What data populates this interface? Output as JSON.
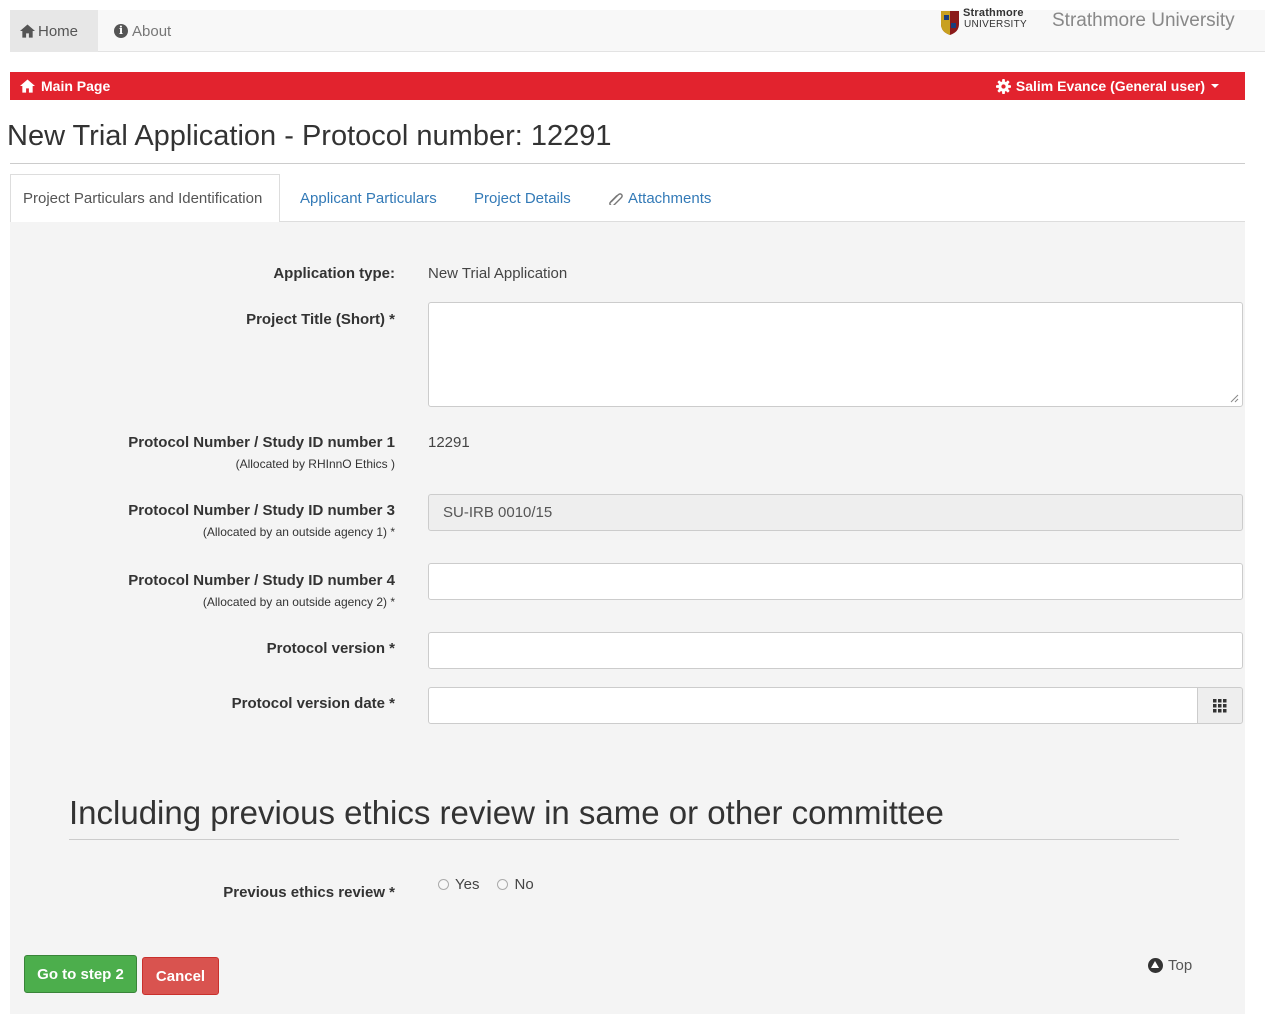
{
  "topnav": {
    "home_label": "Home",
    "about_label": "About",
    "logo_word1": "Strathmore",
    "logo_word2": "UNIVERSITY",
    "brand_name": "Strathmore University"
  },
  "redbar": {
    "main_page_label": "Main Page",
    "user_label": "Salim Evance (General user)"
  },
  "page": {
    "title": "New Trial Application - Protocol number: 12291"
  },
  "tabs": [
    {
      "label": "Project Particulars and Identification",
      "active": true
    },
    {
      "label": "Applicant Particulars",
      "active": false
    },
    {
      "label": "Project Details",
      "active": false
    },
    {
      "label": "Attachments",
      "active": false,
      "icon": "paperclip-icon"
    }
  ],
  "form": {
    "application_type": {
      "label": "Application type:",
      "value": "New Trial Application"
    },
    "project_title": {
      "label": "Project Title (Short) *",
      "value": ""
    },
    "protocol_1": {
      "label": "Protocol Number / Study ID number 1",
      "sub": "(Allocated by RHInnO Ethics )",
      "value": "12291"
    },
    "protocol_3": {
      "label": "Protocol Number / Study ID number 3",
      "sub": "(Allocated by an outside agency 1) *",
      "value": "SU-IRB 0010/15"
    },
    "protocol_4": {
      "label": "Protocol Number / Study ID number 4",
      "sub": "(Allocated by an outside agency 2) *",
      "value": ""
    },
    "protocol_version": {
      "label": "Protocol version *",
      "value": ""
    },
    "protocol_version_date": {
      "label": "Protocol version date *",
      "value": "",
      "icon": "calendar-icon"
    }
  },
  "section": {
    "title": "Including previous ethics review in same or other committee",
    "previous_review_label": "Previous ethics review *",
    "options": [
      "Yes",
      "No"
    ]
  },
  "actions": {
    "step2_label": "Go to step 2",
    "cancel_label": "Cancel",
    "top_label": "Top"
  },
  "colors": {
    "brand_red": "#e2232e",
    "success": "#4cae4c",
    "danger": "#d9534f",
    "link": "#337ab7"
  }
}
